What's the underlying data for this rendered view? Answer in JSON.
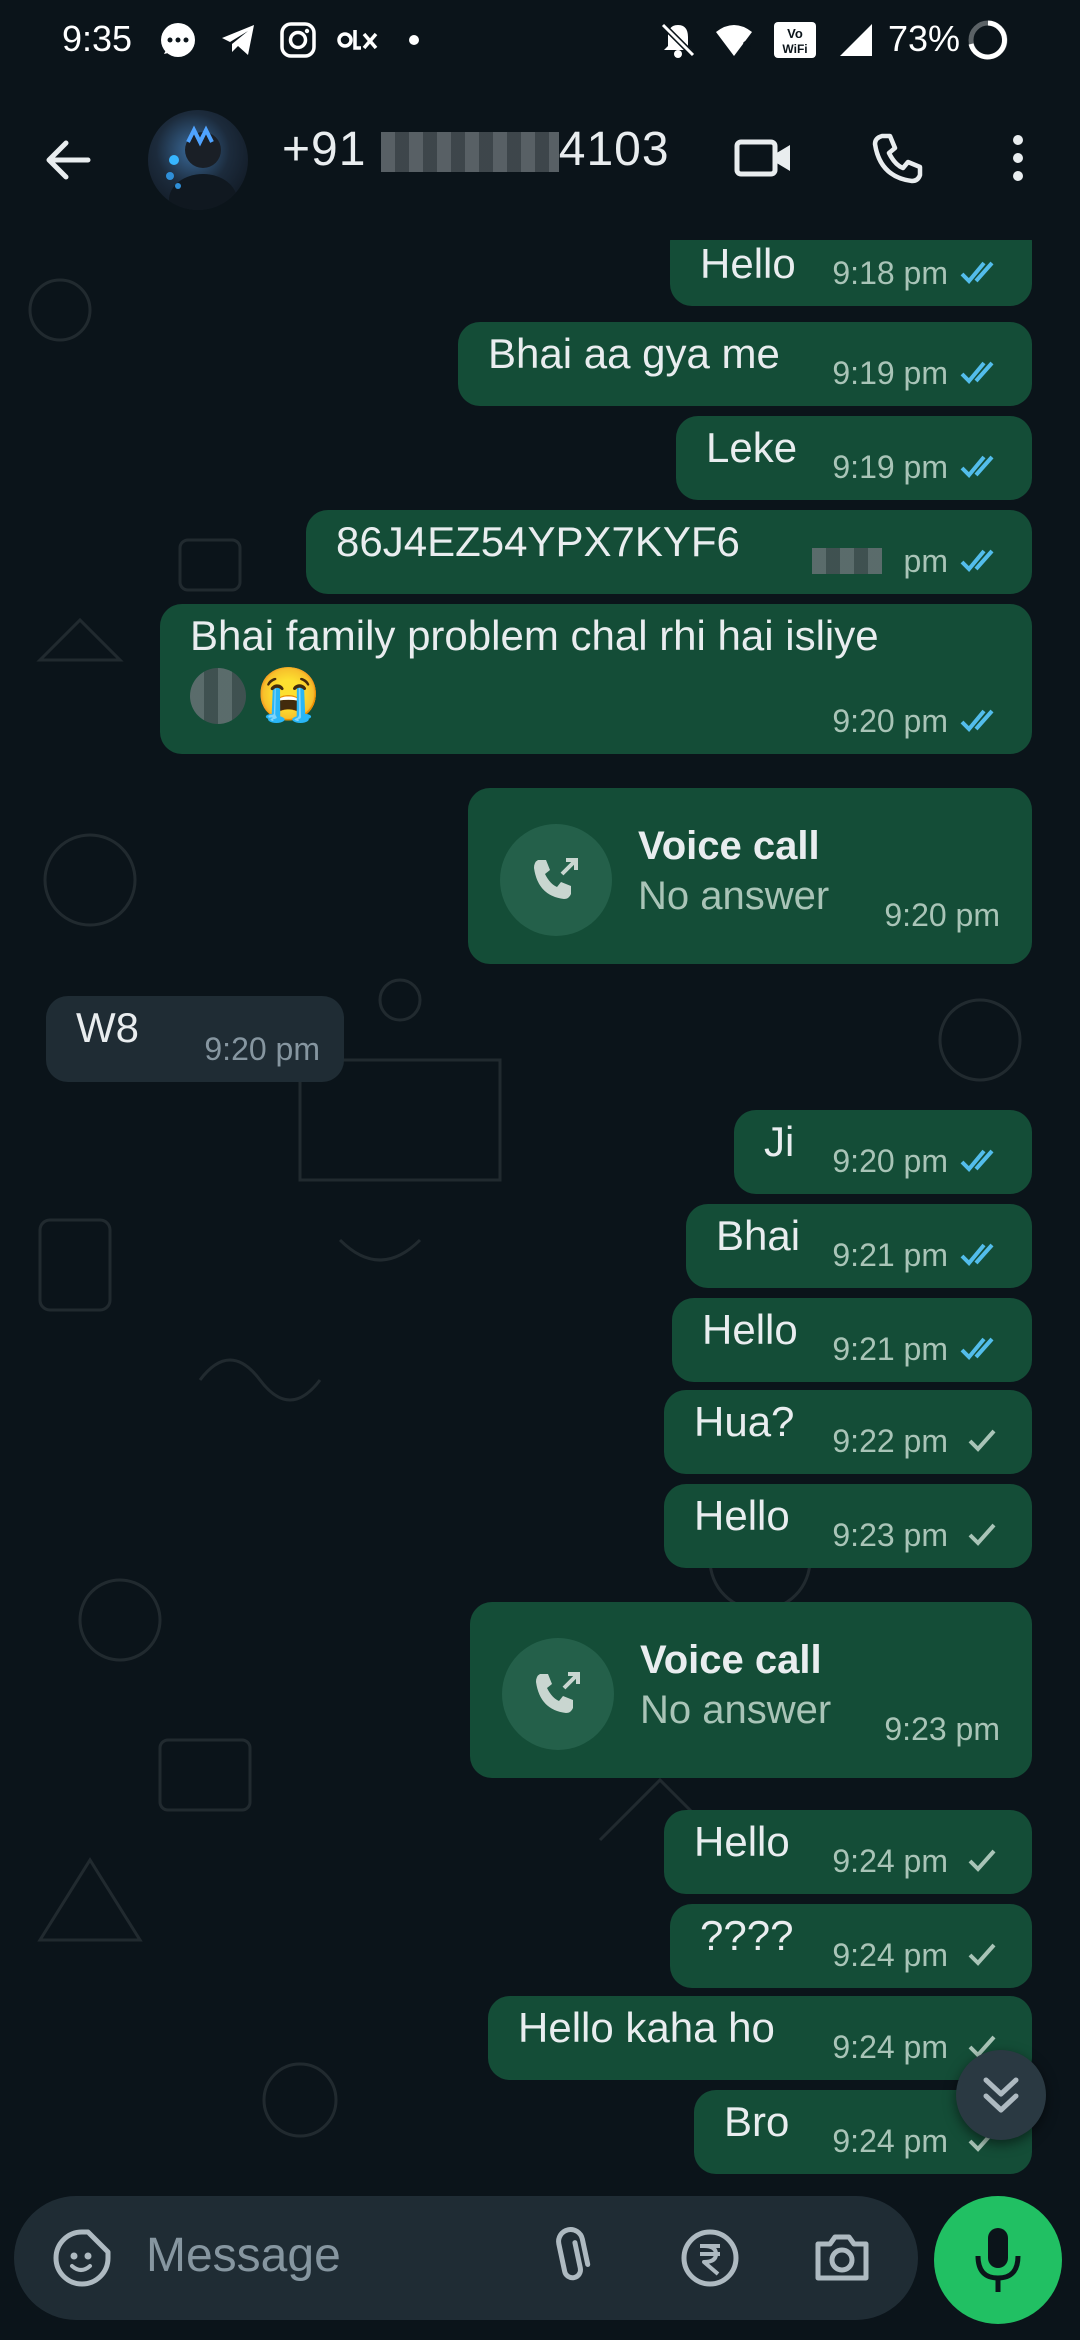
{
  "status_bar": {
    "time": "9:35",
    "battery": "73%",
    "icons": [
      "chat-bubble-icon",
      "telegram-icon",
      "instagram-icon",
      "olx-icon",
      "dot-icon",
      "mute-icon",
      "wifi-icon",
      "vowifi-icon",
      "signal-icon",
      "battery-icon"
    ]
  },
  "header": {
    "contact_prefix": "+91",
    "contact_suffix": "4103",
    "icons": [
      "back-arrow-icon",
      "video-call-icon",
      "phone-icon",
      "more-vert-icon"
    ]
  },
  "messages": [
    {
      "type": "out",
      "text": "Hello",
      "time": "9:18 pm",
      "status": "read"
    },
    {
      "type": "out",
      "text": "Bhai aa gya me",
      "time": "9:19 pm",
      "status": "read"
    },
    {
      "type": "out",
      "text": "Leke",
      "time": "9:19 pm",
      "status": "read"
    },
    {
      "type": "out",
      "text": "86J4EZ54YPX7KYF6",
      "time": "pm",
      "status": "read"
    },
    {
      "type": "out",
      "text": "Bhai family problem chal rhi hai isliye",
      "emoji": "😭",
      "time": "9:20 pm",
      "status": "read"
    },
    {
      "type": "call",
      "title": "Voice call",
      "subtitle": "No answer",
      "time": "9:20 pm"
    },
    {
      "type": "in",
      "text": "W8",
      "time": "9:20 pm"
    },
    {
      "type": "out",
      "text": "Ji",
      "time": "9:20 pm",
      "status": "read"
    },
    {
      "type": "out",
      "text": "Bhai",
      "time": "9:21 pm",
      "status": "read"
    },
    {
      "type": "out",
      "text": "Hello",
      "time": "9:21 pm",
      "status": "read"
    },
    {
      "type": "out",
      "text": "Hua?",
      "time": "9:22 pm",
      "status": "sent"
    },
    {
      "type": "out",
      "text": "Hello",
      "time": "9:23 pm",
      "status": "sent"
    },
    {
      "type": "call",
      "title": "Voice call",
      "subtitle": "No answer",
      "time": "9:23 pm"
    },
    {
      "type": "out",
      "text": "Hello",
      "time": "9:24 pm",
      "status": "sent"
    },
    {
      "type": "out",
      "text": "????",
      "time": "9:24 pm",
      "status": "sent"
    },
    {
      "type": "out",
      "text": "Hello kaha ho",
      "time": "9:24 pm",
      "status": "sent"
    },
    {
      "type": "out",
      "text": "Bro",
      "time": "9:24 pm",
      "status": "sent"
    }
  ],
  "input": {
    "placeholder": "Message",
    "icons": [
      "sticker-icon",
      "attach-icon",
      "rupee-icon",
      "camera-icon",
      "mic-icon"
    ]
  },
  "colors": {
    "background": "#0b141a",
    "outgoing_bubble": "#144d37",
    "incoming_bubble": "#1f2c34",
    "read_ticks": "#53bdeb",
    "mic_button": "#21c063"
  }
}
